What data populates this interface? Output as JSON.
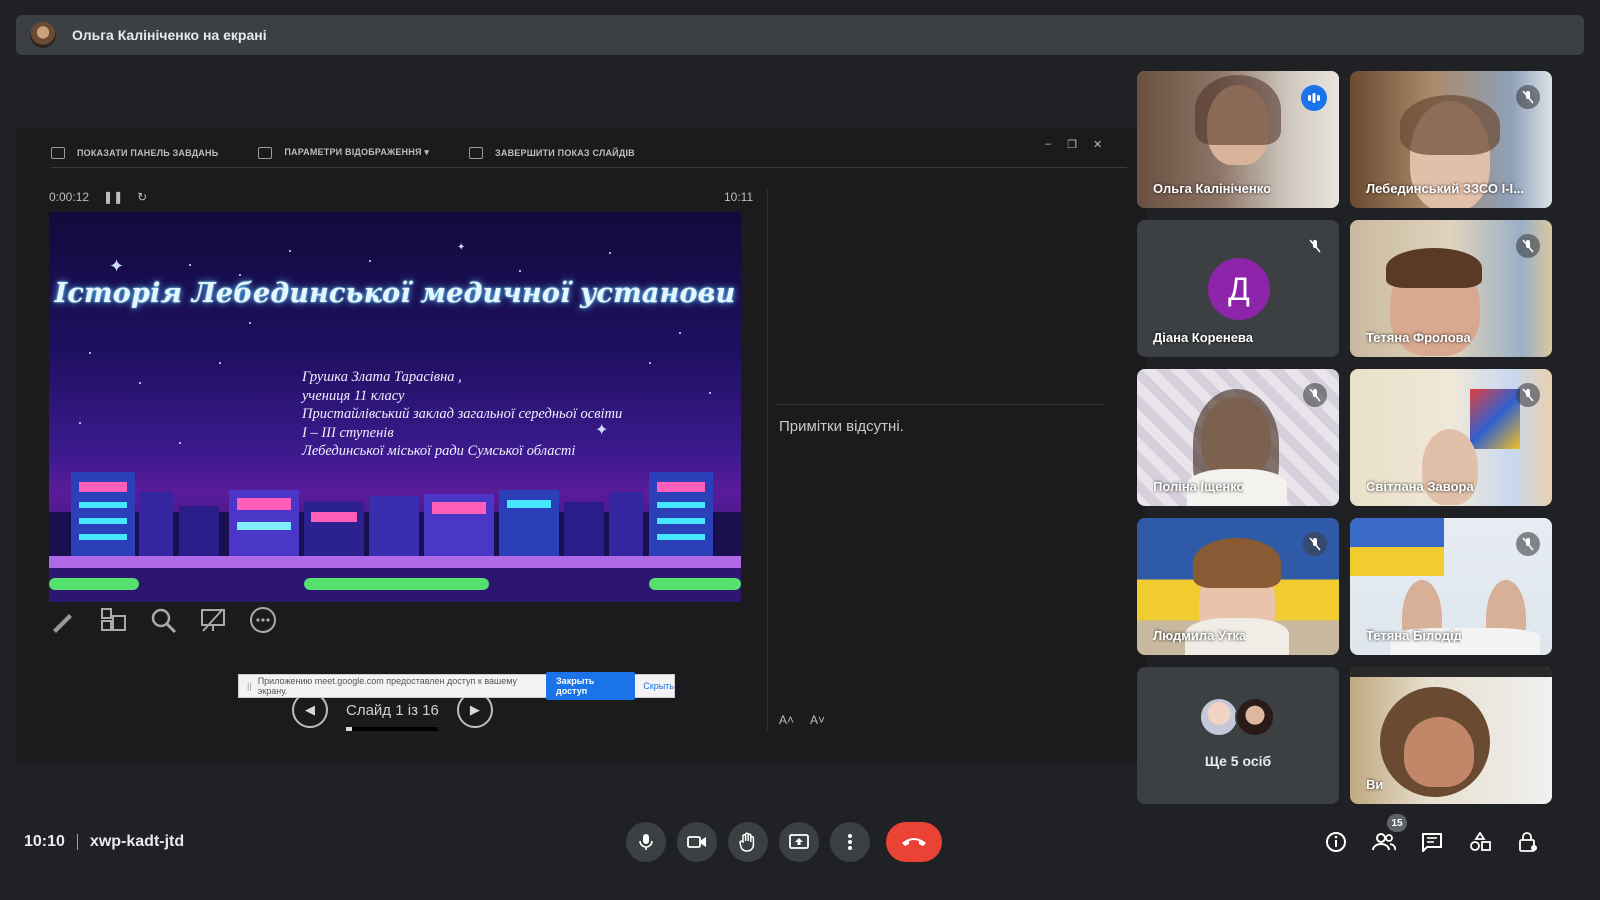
{
  "presenter_bar": {
    "text": "Ольга Калініченко на екрані"
  },
  "presentation": {
    "toolbar": [
      {
        "label": "ПОКАЗАТИ ПАНЕЛЬ ЗАВДАНЬ",
        "icon": "taskbar-icon"
      },
      {
        "label": "ПАРАМЕТРИ ВІДОБРАЖЕННЯ ▾",
        "icon": "display-settings-icon"
      },
      {
        "label": "ЗАВЕРШИТИ ПОКАЗ СЛАЙДІВ",
        "icon": "end-show-icon"
      }
    ],
    "elapsed": "0:00:12",
    "clock": "10:11",
    "notes": "Примітки відсутні.",
    "slide": {
      "title": "Історія Лебединської медичної установи",
      "lines": [
        "Грушка Злата Тарасівна ,",
        "учениця 11 класу",
        "Пристайлівський  заклад загальної середньої освіти",
        "І – ІІІ ступенів",
        "Лебединської міської  ради  Сумської області"
      ]
    },
    "slide_counter": "Слайд 1 із 16",
    "slide_progress": 0.0625,
    "share_notice": {
      "text": "Приложению meet.google.com предоставлен доступ к вашему экрану.",
      "stop": "Закрыть доступ",
      "hide": "Скрыть"
    }
  },
  "participants": [
    {
      "name": "Ольга Калініченко",
      "state": "speaking"
    },
    {
      "name": "Лебединський ЗЗСО І-І...",
      "state": "muted"
    },
    {
      "name": "Діана Коренева",
      "state": "muted",
      "initial": "Д"
    },
    {
      "name": "Тетяна Фролова",
      "state": "muted"
    },
    {
      "name": "Поліна Іщенко",
      "state": "muted"
    },
    {
      "name": "Світлана Завора",
      "state": "muted"
    },
    {
      "name": "Людмила Утка",
      "state": "muted"
    },
    {
      "name": "Тетяна Білодід",
      "state": "muted"
    },
    {
      "name": "Ще 5 осіб",
      "state": "more"
    },
    {
      "name": "Ви",
      "state": "self"
    }
  ],
  "bottom": {
    "time": "10:10",
    "meeting_code": "xwp-kadt-jtd",
    "participants_count": "15"
  },
  "colors": {
    "end_call": "#ea4335",
    "accent": "#8ab4f8",
    "avatar_purple": "#8e24aa"
  }
}
